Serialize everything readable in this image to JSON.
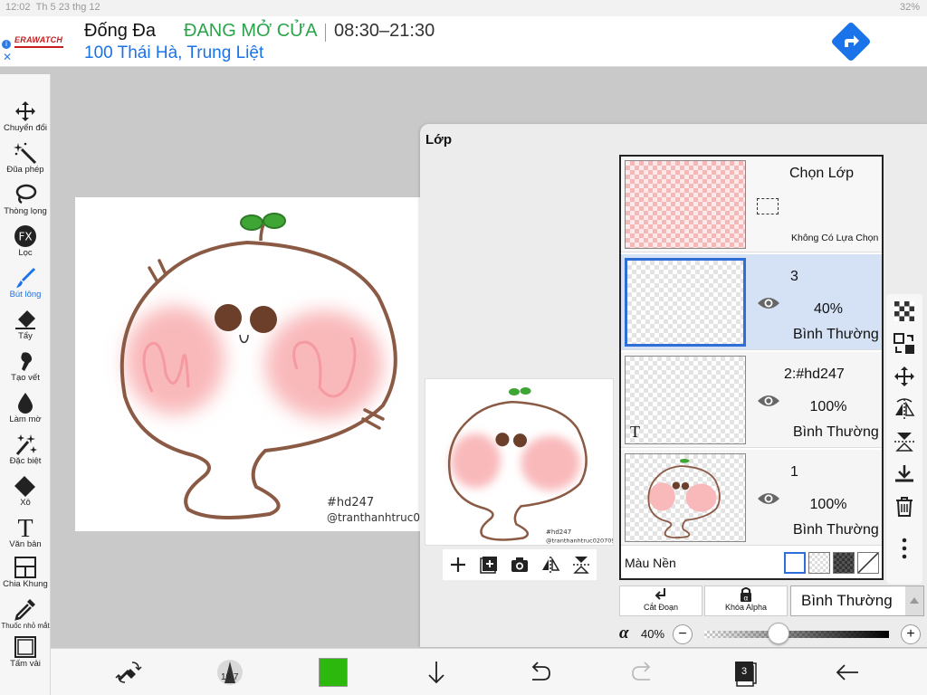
{
  "status_bar": {
    "time": "12:02",
    "date": "Th 5 23 thg 12",
    "battery": "32%"
  },
  "ad": {
    "brand": "ERAWATCH",
    "title": "Đống Đa",
    "status": "ĐANG MỞ CỬA",
    "hours": "08:30–21:30",
    "address": "100 Thái Hà, Trung Liệt",
    "info_icon": "i",
    "close_icon": "✕"
  },
  "left_tools": [
    {
      "label": "Chuyển đổi",
      "icon": "move-icon"
    },
    {
      "label": "Đũa phép",
      "icon": "magic-wand-icon"
    },
    {
      "label": "Thòng lọng",
      "icon": "lasso-icon"
    },
    {
      "label": "Lọc",
      "icon": "fx-icon",
      "glyph": "FX"
    },
    {
      "label": "Bút lông",
      "icon": "brush-icon",
      "active": true
    },
    {
      "label": "Tẩy",
      "icon": "eraser-icon"
    },
    {
      "label": "Tạo vết",
      "icon": "smudge-icon"
    },
    {
      "label": "Làm mờ",
      "icon": "blur-drop-icon"
    },
    {
      "label": "Đặc biệt",
      "icon": "special-icon"
    },
    {
      "label": "Xô",
      "icon": "bucket-icon"
    },
    {
      "label": "Văn bản",
      "icon": "text-icon",
      "glyph": "T"
    },
    {
      "label": "Chia Khung",
      "icon": "frame-divide-icon"
    },
    {
      "label": "Thuốc nhỏ mắt",
      "icon": "eyedropper-icon"
    },
    {
      "label": "Tấm vải",
      "icon": "canvas-icon"
    }
  ],
  "canvas": {
    "watermark_line1": "#hd247",
    "watermark_line2": "@tranthanhtruc020709"
  },
  "layer_panel": {
    "title": "Lớp",
    "selection_row": {
      "title": "Chọn Lớp",
      "subtitle": "Không Có Lựa Chọn"
    },
    "layers": [
      {
        "name": "3",
        "opacity": "40%",
        "blend": "Bình Thường",
        "selected": true,
        "visible": true
      },
      {
        "name": "2:#hd247",
        "opacity": "100%",
        "blend": "Bình Thường",
        "selected": false,
        "visible": true,
        "type_glyph": "T"
      },
      {
        "name": "1",
        "opacity": "100%",
        "blend": "Bình Thường",
        "selected": false,
        "visible": true
      }
    ],
    "background_label": "Màu Nền",
    "clip_label": "Cắt Đoạn",
    "alpha_lock_label": "Khóa Alpha",
    "blend_mode": "Bình Thường",
    "alpha_symbol": "α",
    "alpha_value": "40%",
    "alpha_fraction": 0.4,
    "minus": "−",
    "plus": "+"
  },
  "bottom_toolbar": {
    "brush_size": "19.7",
    "color": "#2db80e",
    "layer_count": "3"
  },
  "colors": {
    "accent": "#1a73e8",
    "selected_row": "#d5e2f5",
    "open_green": "#2aa44a"
  }
}
